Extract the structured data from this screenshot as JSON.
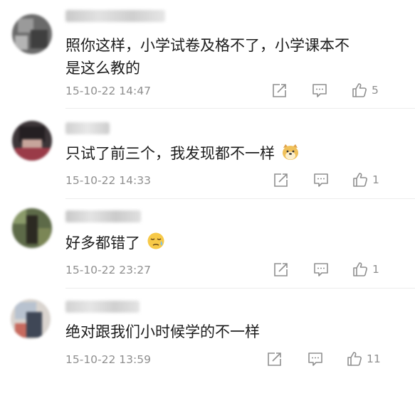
{
  "comments": [
    {
      "text": "照你这样，小学试卷及格不了，小学课本不是这么教的",
      "line1": "照你这样，小学试卷及格不了，小学课本不",
      "line2": "是这么教的",
      "timestamp": "15-10-22 14:47",
      "likes": "5",
      "emoji": ""
    },
    {
      "text": "只试了前三个，我发现都不一样",
      "timestamp": "15-10-22 14:33",
      "likes": "1",
      "emoji": "doge-emoji"
    },
    {
      "text": "好多都错了",
      "timestamp": "15-10-22 23:27",
      "likes": "1",
      "emoji": "sad-sweat-emoji"
    },
    {
      "text": "绝对跟我们小时候学的不一样",
      "timestamp": "15-10-22 13:59",
      "likes": "11",
      "emoji": ""
    }
  ],
  "colors": {
    "text": "#1c1c1c",
    "meta": "#8f8f8f",
    "divider": "#ececec"
  },
  "icons": [
    "share-icon",
    "reply-icon",
    "thumbs-up-icon"
  ]
}
